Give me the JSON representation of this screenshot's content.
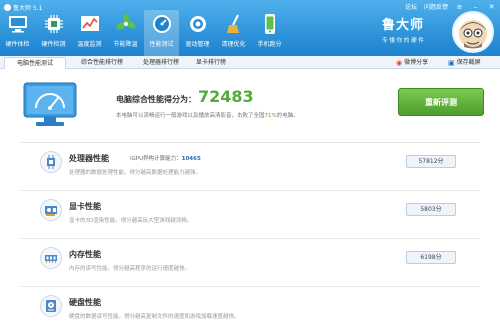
{
  "app": {
    "title": "鲁大师 5.1"
  },
  "window_controls": {
    "forum": "论坛",
    "feedback": "问题反馈"
  },
  "toolbar": [
    {
      "label": "硬件体检",
      "icon": "monitor-icon"
    },
    {
      "label": "硬件检测",
      "icon": "chip-icon"
    },
    {
      "label": "温度监测",
      "icon": "chart-icon"
    },
    {
      "label": "节能降温",
      "icon": "fan-icon"
    },
    {
      "label": "性能测试",
      "icon": "speedometer-icon"
    },
    {
      "label": "驱动管理",
      "icon": "gear-icon"
    },
    {
      "label": "清理优化",
      "icon": "broom-icon"
    },
    {
      "label": "手机跑分",
      "icon": "phone-icon"
    }
  ],
  "brand": {
    "name": "鲁大师",
    "slogan": "专 懂 你 的 硬 件"
  },
  "tabs": [
    "电脑性能测试",
    "综合性能排行榜",
    "处理器排行榜",
    "显卡排行榜"
  ],
  "tab_actions": {
    "share": "微博分享",
    "save": "保存截屏"
  },
  "score": {
    "label": "电脑综合性能得分为：",
    "value": "72483",
    "desc_before": "本电脑可以流畅运行一般游戏以及播放高清影音，击败了全国",
    "desc_percent": "71%",
    "desc_after": "的电脑。",
    "retest": "重新评测"
  },
  "rows": [
    {
      "title": "处理器性能",
      "sub_label": "iGPU异构计算能力：",
      "sub_value": "10465",
      "desc": "处理器的数据处理性能，得分越高数据处理能力越强。",
      "score": "57812分",
      "icon": "cpu-icon"
    },
    {
      "title": "显卡性能",
      "sub_label": "",
      "sub_value": "",
      "desc": "显卡的3D渲染性能，得分越高玩大型游戏越流畅。",
      "score": "5803分",
      "icon": "graphics-card-icon"
    },
    {
      "title": "内存性能",
      "sub_label": "",
      "sub_value": "",
      "desc": "内存的读写性能，得分越高程序的运行速度越快。",
      "score": "6198分",
      "icon": "memory-icon"
    },
    {
      "title": "硬盘性能",
      "sub_label": "",
      "sub_value": "",
      "desc": "硬盘的数据读写性能，得分越高复制文件的速度和游戏加载速度越快。",
      "score": "",
      "icon": "disk-icon"
    }
  ]
}
